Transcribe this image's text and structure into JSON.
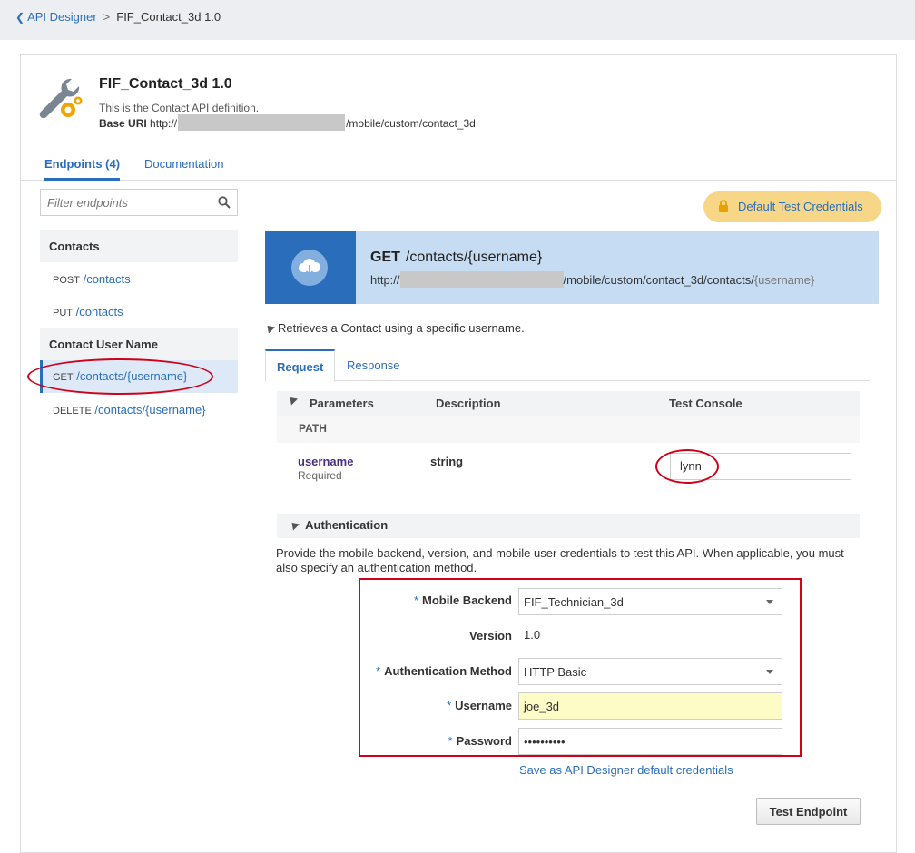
{
  "breadcrumb": {
    "back_label": "API Designer",
    "separator": ">",
    "current": "FIF_Contact_3d 1.0"
  },
  "api": {
    "title": "FIF_Contact_3d 1.0",
    "description": "This is the Contact API definition.",
    "base_uri_label": "Base URI",
    "base_uri_prefix": "http://",
    "base_uri_suffix": "/mobile/custom/contact_3d",
    "icon": "wrench-gear-icon"
  },
  "top_tabs": [
    {
      "label": "Endpoints (4)",
      "active": true
    },
    {
      "label": "Documentation",
      "active": false
    }
  ],
  "sidebar": {
    "filter_placeholder": "Filter endpoints",
    "groups": [
      {
        "title": "Contacts",
        "endpoints": [
          {
            "method": "POST",
            "path": "/contacts"
          },
          {
            "method": "PUT",
            "path": "/contacts"
          }
        ]
      },
      {
        "title": "Contact User Name",
        "endpoints": [
          {
            "method": "GET",
            "path": "/contacts/{username}",
            "selected": true
          },
          {
            "method": "DELETE",
            "path": "/contacts/{username}"
          }
        ]
      }
    ]
  },
  "credentials_button": "Default Test Credentials",
  "endpoint": {
    "method": "GET",
    "path": "/contacts/{username}",
    "url_prefix": "http://",
    "url_suffix": "/mobile/custom/contact_3d/contacts/",
    "url_param": "{username}",
    "summary": "Retrieves a Contact using a specific username."
  },
  "req_tabs": [
    {
      "label": "Request",
      "active": true
    },
    {
      "label": "Response",
      "active": false
    }
  ],
  "parameters": {
    "headers": [
      "Parameters",
      "Description",
      "Test Console"
    ],
    "section": "PATH",
    "rows": [
      {
        "name": "username",
        "required": "Required",
        "type": "string",
        "value": "lynn"
      }
    ]
  },
  "auth": {
    "title": "Authentication",
    "text": "Provide the mobile backend, version, and mobile user credentials to test this API. When applicable, you must also specify an authentication method.",
    "required_marker": "*",
    "fields": {
      "mobile_backend": {
        "label": "Mobile Backend",
        "value": "FIF_Technician_3d"
      },
      "version": {
        "label": "Version",
        "value": "1.0"
      },
      "auth_method": {
        "label": "Authentication Method",
        "value": "HTTP Basic"
      },
      "username": {
        "label": "Username",
        "value": "joe_3d"
      },
      "password": {
        "label": "Password",
        "value": "••••••••••"
      }
    },
    "save_link": "Save as API Designer default credentials"
  },
  "test_button": "Test Endpoint",
  "colors": {
    "accent": "#2a6ebb",
    "annotation_red": "#d0021b",
    "credentials_bg": "#f7d687",
    "banner_bg": "#c6dcf2"
  }
}
